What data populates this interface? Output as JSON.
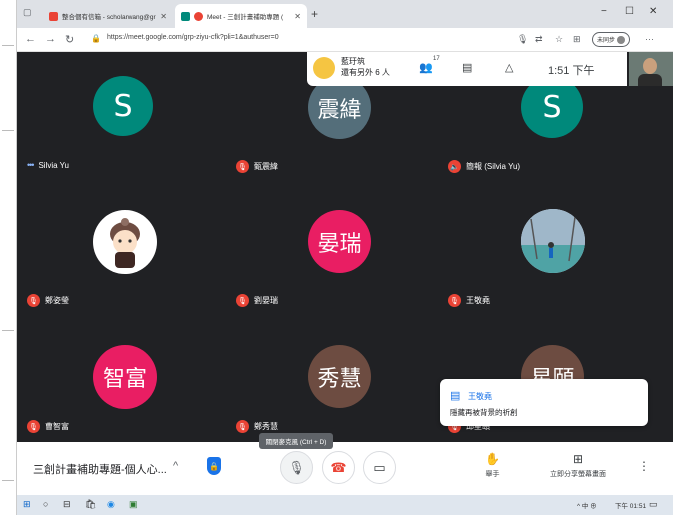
{
  "browser": {
    "tabs": [
      {
        "label": "整合個有信箱 - scholarwang@gr",
        "favicon_color": "#ea4335"
      },
      {
        "label": "Meet - 三創計畫補助專題 (",
        "favicon_color": "#00897b"
      }
    ],
    "new_tab": "+",
    "window_controls": {
      "minimize": "−",
      "maximize": "☐",
      "close": "✕"
    },
    "url": "https://meet.google.com/grp-ziyu-cfk?pli=1&authuser=0",
    "profile_label": "未同步"
  },
  "meet": {
    "host_line1": "藍玗筑",
    "host_line2": "還有另外 6 人",
    "participants_count": "17",
    "time": "1:51 下午",
    "tiles": [
      {
        "initials": "S",
        "name": "Silvia Yu",
        "bg": "#00897b",
        "state": "speaking"
      },
      {
        "initials": "震緯",
        "name": "甄震緯",
        "bg": "#546e7a",
        "state": "muted"
      },
      {
        "initials": "S",
        "name": "簡報 (Silvia Yu)",
        "bg": "#00897b",
        "state": "muted"
      },
      {
        "initials": "",
        "name": "鄭姿瑩",
        "bg": "#ffffff",
        "state": "muted",
        "photo": "cartoon-avatar"
      },
      {
        "initials": "晏瑞",
        "name": "劉晏瑞",
        "bg": "#e91e63",
        "state": "muted"
      },
      {
        "initials": "",
        "name": "王敬堯",
        "bg": "#c8d8e8",
        "state": "muted",
        "photo": "sports-court"
      },
      {
        "initials": "智富",
        "name": "曹智富",
        "bg": "#e91e63",
        "state": "muted"
      },
      {
        "initials": "秀慧",
        "name": "鄭秀慧",
        "bg": "#6d4c41",
        "state": "muted"
      },
      {
        "initials": "星頤",
        "name": "邱星頤",
        "bg": "#6d4c41",
        "state": "muted"
      }
    ],
    "toast": {
      "sender": "王敬堯",
      "message": "隱藏再被背景的祈創"
    },
    "tooltip": "關閉麥克風 (Ctrl + D)"
  },
  "controls": {
    "meeting_title": "三創計畫補助專題-個人心...",
    "raise_hand_label": "舉手",
    "present_label": "立即分享螢幕畫面"
  },
  "taskbar": {
    "time": "下午 01:51",
    "tray_text": "^ 中 ⊕"
  }
}
